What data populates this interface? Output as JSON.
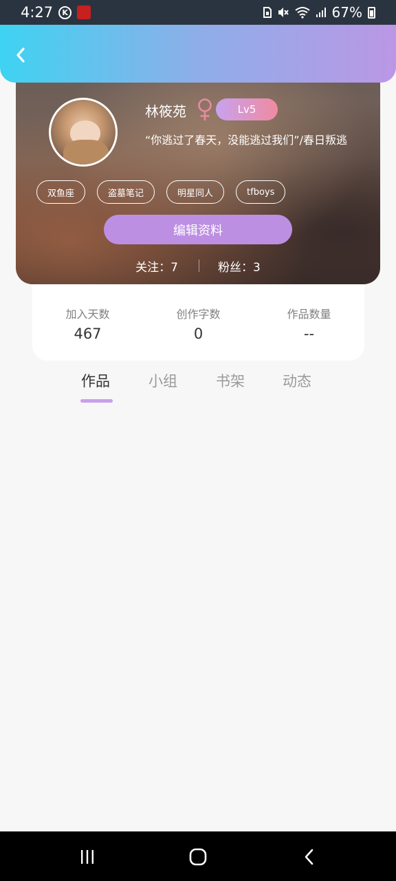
{
  "status_bar": {
    "time": "4:27",
    "k_icon": "K",
    "battery": "67%",
    "icons": [
      "k-circle-icon",
      "app-notification-icon",
      "sim-icon",
      "mute-icon",
      "wifi-icon",
      "signal-icon",
      "battery-icon"
    ]
  },
  "header": {
    "back_icon": "chevron-left-icon"
  },
  "profile": {
    "name": "林筱苑",
    "gender_icon": "female-icon",
    "level": "Lv5",
    "signature": "“你逃过了春天，没能逃过我们”/春日叛逃",
    "tags": [
      "双鱼座",
      "盗墓笔记",
      "明星同人",
      "tfboys"
    ],
    "edit_button": "编辑资料",
    "follow": "关注：7",
    "fans": "粉丝：3"
  },
  "stats": [
    {
      "label": "加入天数",
      "value": "467"
    },
    {
      "label": "创作字数",
      "value": "0"
    },
    {
      "label": "作品数量",
      "value": "--"
    }
  ],
  "tabs": [
    {
      "label": "作品",
      "active": true
    },
    {
      "label": "小组",
      "active": false
    },
    {
      "label": "书架",
      "active": false
    },
    {
      "label": "动态",
      "active": false
    }
  ],
  "colors": {
    "header_gradient_start": "#3ed3f2",
    "header_gradient_end": "#bb97e6",
    "accent_purple": "#bd8fe3",
    "gender_pink": "#e88aa2"
  },
  "nav_icons": [
    "recent-apps-icon",
    "home-icon",
    "back-icon"
  ]
}
